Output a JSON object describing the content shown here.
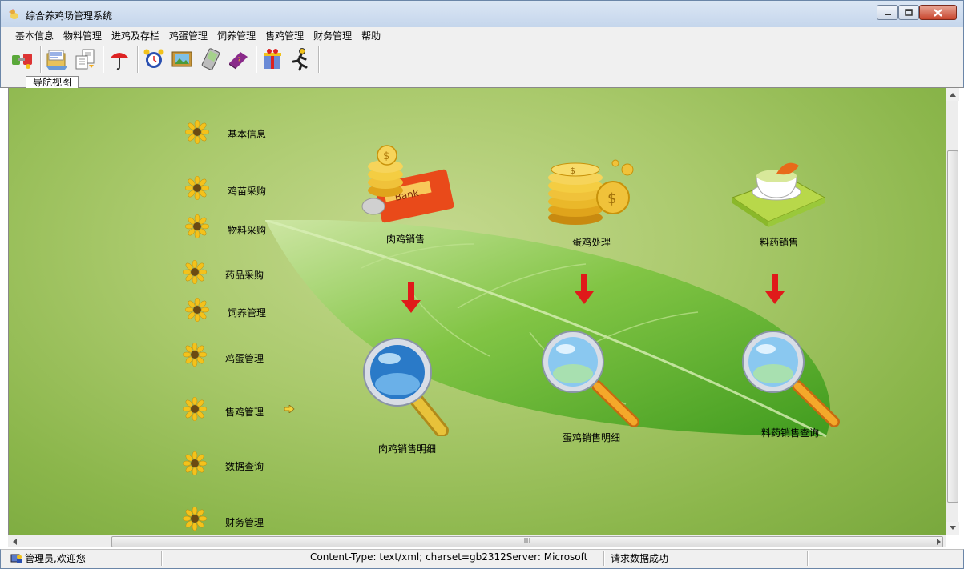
{
  "window": {
    "title": "综合养鸡场管理系统",
    "minimize_icon": "minimize-icon",
    "maximize_icon": "maximize-icon",
    "close_icon": "close-icon"
  },
  "menu": [
    "基本信息",
    "物料管理",
    "进鸡及存栏",
    "鸡蛋管理",
    "饲养管理",
    "售鸡管理",
    "财务管理",
    "帮助"
  ],
  "toolbar_icons": [
    "connect-icon",
    "folder-list-icon",
    "document-transfer-icon",
    "umbrella-icon",
    "alarm-clock-icon",
    "picture-frame-icon",
    "handheld-icon",
    "book-icon",
    "gift-box-icon",
    "running-man-icon"
  ],
  "tab": {
    "label": "导航视图"
  },
  "nav": [
    {
      "label": "基本信息"
    },
    {
      "label": "鸡苗采购"
    },
    {
      "label": "物料采购"
    },
    {
      "label": "药品采购"
    },
    {
      "label": "饲养管理"
    },
    {
      "label": "鸡蛋管理"
    },
    {
      "label": "售鸡管理"
    },
    {
      "label": "数据查询"
    },
    {
      "label": "财务管理"
    }
  ],
  "features": {
    "meat_sales": "肉鸡销售",
    "egg_processing": "蛋鸡处理",
    "feed_sales": "料药销售",
    "meat_sales_detail": "肉鸡销售明细",
    "egg_sales_detail": "蛋鸡销售明细",
    "feed_sales_query": "料药销售查询"
  },
  "status": {
    "user": "管理员,欢迎您",
    "content_type": "Content-Type: text/xml; charset=gb2312Server: Microsoft",
    "message": "请求数据成功"
  },
  "colors": {
    "background_green": "#a9c96b",
    "arrow_red": "#e01a1a",
    "flower_yellow": "#f4c21b"
  }
}
